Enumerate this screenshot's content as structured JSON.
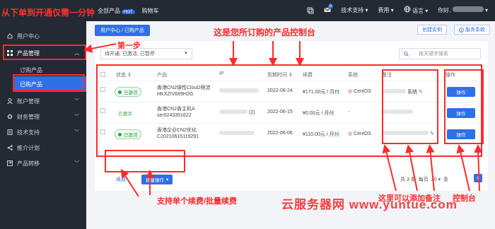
{
  "colors": {
    "accent": "#2f6fe8",
    "sidebar_bg": "#232a33",
    "annotation": "#ff2b2b",
    "status_green": "#2f9e44"
  },
  "top_annotation": "从下单到开通仅需一分钟",
  "topnav": {
    "all_products": "全部产品",
    "hot": "HOT",
    "cart": "购物车"
  },
  "topright": {
    "mail_count": "0",
    "support": "技术支持",
    "billing": "费用",
    "language": "语言",
    "greeting": "你好,"
  },
  "sidebar": {
    "user_center": "用户中心",
    "product_mgmt": "产品管理",
    "order_products": "订购产品",
    "purchased_products": "已购产品",
    "account_mgmt": "账户管理",
    "finance_mgmt": "财务管理",
    "tech_support": "技术支持",
    "referral": "推介计划",
    "product_transfer": "产品转移"
  },
  "breadcrumb": "用户中心 / 已购产品",
  "buttons": {
    "create_instance": "创建实例",
    "service_terms": "服务条款"
  },
  "filter_value": "待开通, 已激活, 已暂停",
  "search_placeholder": "按关键字搜索",
  "table": {
    "headers": [
      "状态",
      "产品",
      "IP",
      "到期时间",
      "续费",
      "系统",
      "备注",
      "操作"
    ],
    "rows": [
      {
        "status": "已激活",
        "product": "香港CN2弹性ClouD限流",
        "code": "HKXZIV689H2G",
        "ip": "",
        "due": "2022-08-24",
        "price": "¥171.00元 / 月付",
        "os": "CentOS",
        "note": "系统",
        "op": "操作"
      },
      {
        "status": "已激活",
        "product": "香港CN2香主机A",
        "code": "ser5243351622",
        "ip": "(2)",
        "due": "2022-06-15",
        "price": "¥0.00元 / 月付",
        "os": "-",
        "note": "",
        "op": "操作"
      },
      {
        "status": "已激活",
        "product": "香港企业CN2优化",
        "code": "C20210615119291",
        "ip": "",
        "due": "2022-06-06",
        "price": "¥110.00元 / 月付",
        "os": "CentOS",
        "note": "",
        "op": "操作"
      }
    ]
  },
  "bottom": {
    "renew": "续费",
    "bulk": "批量操作",
    "total": "共 3 条",
    "per_page": "每页",
    "page_size": "20",
    "unit": "条",
    "page": "1"
  },
  "annotations": {
    "controls_title": "这是您所订购的产品控制台",
    "step1": "第一步",
    "renew_note": "支持单个续费/批量续费",
    "note_here": "这里可以添加备注",
    "console": "控制台",
    "watermark": "云服务器网 www.yuntue.com"
  }
}
